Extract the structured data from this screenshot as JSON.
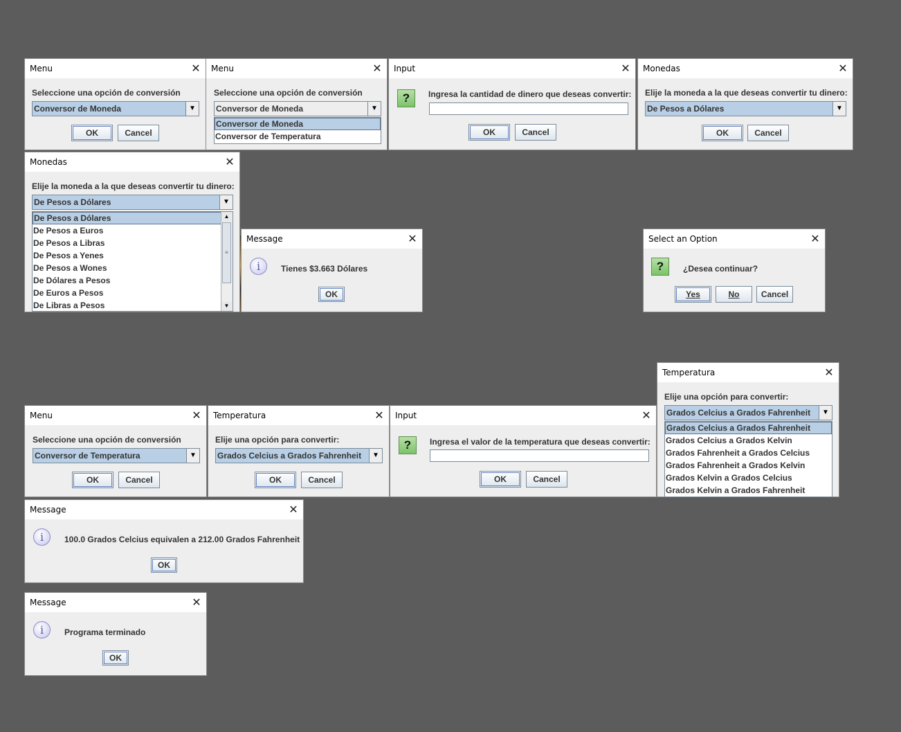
{
  "d1": {
    "title": "Menu",
    "label": "Seleccione una opción de conversión",
    "combo": "Conversor de Moneda",
    "ok": "OK",
    "cancel": "Cancel"
  },
  "d2": {
    "title": "Menu",
    "label": "Seleccione una opción de conversión",
    "combo": "Conversor de Moneda",
    "options": [
      "Conversor de Moneda",
      "Conversor de Temperatura"
    ]
  },
  "d3": {
    "title": "Input",
    "label": "Ingresa la cantidad de dinero que deseas convertir:",
    "value": "",
    "ok": "OK",
    "cancel": "Cancel"
  },
  "d4": {
    "title": "Monedas",
    "label": "Elije la moneda a la que deseas convertir tu dinero:",
    "combo": "De Pesos a Dólares",
    "ok": "OK",
    "cancel": "Cancel"
  },
  "d5": {
    "title": "Monedas",
    "label": "Elije la moneda a la que deseas convertir tu dinero:",
    "combo": "De Pesos a Dólares",
    "options": [
      "De Pesos a Dólares",
      "De Pesos a Euros",
      "De Pesos a Libras",
      "De Pesos a Yenes",
      "De Pesos a Wones",
      "De Dólares a Pesos",
      "De Euros a Pesos",
      "De Libras a Pesos"
    ]
  },
  "d6": {
    "title": "Message",
    "text": "Tienes $3.663 Dólares",
    "ok": "OK"
  },
  "d7": {
    "title": "Select an Option",
    "text": "¿Desea continuar?",
    "yes": "Yes",
    "no": "No",
    "cancel": "Cancel"
  },
  "d8": {
    "title": "Temperatura",
    "label": "Elije una opción para convertir:",
    "combo": "Grados Celcius a Grados Fahrenheit",
    "options": [
      "Grados Celcius a Grados Fahrenheit",
      "Grados Celcius a Grados Kelvin",
      "Grados Fahrenheit a Grados Celcius",
      "Grados Fahrenheit a Grados Kelvin",
      "Grados Kelvin a Grados Celcius",
      "Grados Kelvin a Grados Fahrenheit"
    ]
  },
  "d9": {
    "title": "Menu",
    "label": "Seleccione una opción de conversión",
    "combo": "Conversor de Temperatura",
    "ok": "OK",
    "cancel": "Cancel"
  },
  "d10": {
    "title": "Temperatura",
    "label": "Elije una opción para convertir:",
    "combo": "Grados Celcius a Grados Fahrenheit",
    "ok": "OK",
    "cancel": "Cancel"
  },
  "d11": {
    "title": "Input",
    "label": "Ingresa el valor de la temperatura que deseas convertir:",
    "value": "",
    "ok": "OK",
    "cancel": "Cancel"
  },
  "d12": {
    "title": "Message",
    "text": "100.0 Grados Celcius equivalen a 212.00 Grados Fahrenheit",
    "ok": "OK"
  },
  "d13": {
    "title": "Message",
    "text": "Programa terminado",
    "ok": "OK"
  },
  "close_glyph": "✕",
  "arrow_glyph": "▼",
  "question_glyph": "?",
  "info_glyph": "i",
  "colors": {
    "desktop": "#5c5c5c",
    "dialog": "#eeeeee",
    "selection": "#b8cfe5"
  }
}
